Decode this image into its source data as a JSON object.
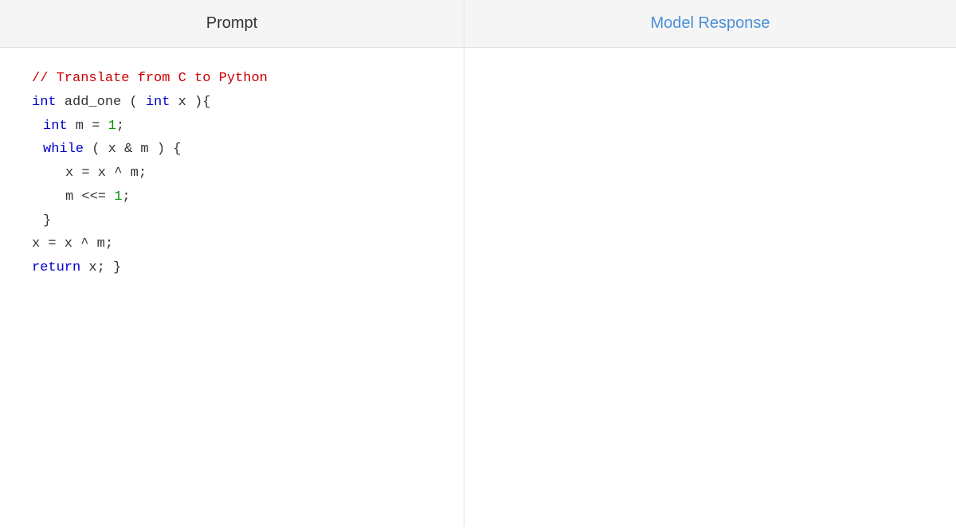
{
  "header": {
    "prompt_label": "Prompt",
    "response_label": "Model Response"
  },
  "prompt": {
    "lines": [
      {
        "id": "line1",
        "parts": [
          {
            "text": "// Translate from C to Python",
            "color": "comment"
          }
        ]
      },
      {
        "id": "line2",
        "parts": [
          {
            "text": "int",
            "color": "keyword"
          },
          {
            "text": " add_one ( ",
            "color": "plain"
          },
          {
            "text": "int",
            "color": "keyword"
          },
          {
            "text": " x ){",
            "color": "plain"
          }
        ]
      },
      {
        "id": "line3",
        "indent": 1,
        "parts": [
          {
            "text": "int",
            "color": "keyword"
          },
          {
            "text": " m = ",
            "color": "plain"
          },
          {
            "text": "1",
            "color": "number"
          },
          {
            "text": ";",
            "color": "plain"
          }
        ]
      },
      {
        "id": "line4",
        "indent": 1,
        "parts": [
          {
            "text": "while",
            "color": "keyword"
          },
          {
            "text": " ( x & m ) {",
            "color": "plain"
          }
        ]
      },
      {
        "id": "line5",
        "indent": 2,
        "parts": [
          {
            "text": "x = x ^ m;",
            "color": "plain"
          }
        ]
      },
      {
        "id": "line6",
        "indent": 2,
        "parts": [
          {
            "text": "m <<= ",
            "color": "plain"
          },
          {
            "text": "1",
            "color": "number"
          },
          {
            "text": ";",
            "color": "plain"
          }
        ]
      },
      {
        "id": "line7",
        "indent": 1,
        "parts": [
          {
            "text": "}",
            "color": "plain"
          }
        ]
      },
      {
        "id": "line8",
        "parts": [
          {
            "text": "x = x ^ m;",
            "color": "plain"
          }
        ]
      },
      {
        "id": "line9",
        "parts": [
          {
            "text": "return",
            "color": "keyword"
          },
          {
            "text": " x; }",
            "color": "plain"
          }
        ]
      }
    ]
  }
}
